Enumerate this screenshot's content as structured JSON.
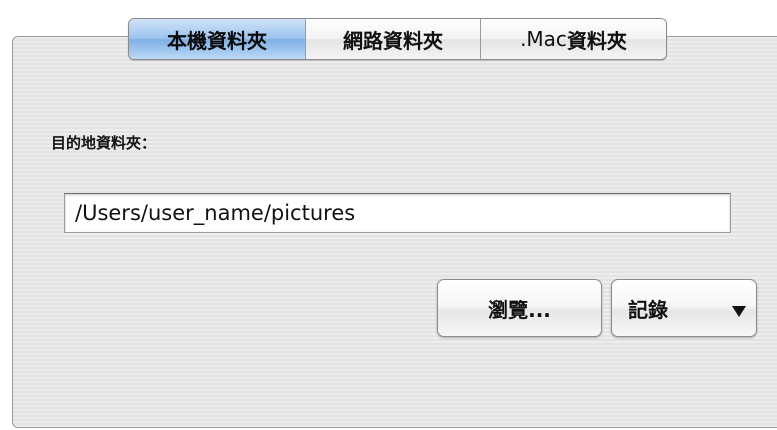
{
  "tabs": [
    {
      "label": "本機資料夾",
      "selected": true
    },
    {
      "label": "網路資料夾",
      "selected": false
    },
    {
      "label_prefix": ".Mac",
      "label_suffix": "資料夾",
      "selected": false
    }
  ],
  "destination": {
    "label": "目的地資料夾：",
    "value": "/Users/user_name/pictures"
  },
  "buttons": {
    "browse_label": "瀏覽...",
    "history_label": "記錄"
  },
  "icons": {
    "history_dropdown": "triangle-down-icon"
  },
  "colors": {
    "selected_tab": "#8cb8ea",
    "panel_background": "#ececec"
  }
}
